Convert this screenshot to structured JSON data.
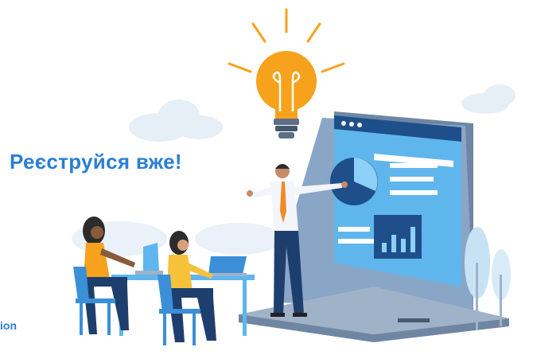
{
  "headline": "Реєструйся вже!",
  "partial_caption": "ion",
  "colors": {
    "accent_blue": "#2a7fd4",
    "bulb_orange": "#f6a21d",
    "screen_blue": "#5fb6ec",
    "laptop_gray": "#7c8ea6",
    "cloud": "#e4edf5"
  },
  "icons": [
    "lightbulb-icon",
    "pie-chart-icon",
    "bar-chart-icon",
    "laptop-icon"
  ]
}
